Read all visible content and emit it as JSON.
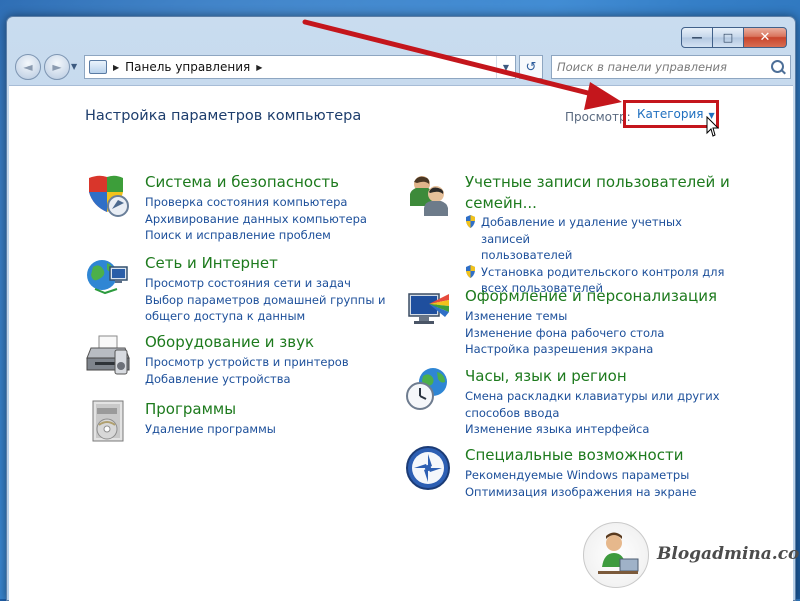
{
  "window": {
    "buttons": {
      "minimize": "—",
      "maximize": "□",
      "close": "✕"
    }
  },
  "nav": {
    "back_glyph": "◄",
    "forward_glyph": "►",
    "dropdown_glyph": "▼",
    "breadcrumb": "Панель управления",
    "separator": "▶",
    "refresh_glyph": "↺"
  },
  "search": {
    "placeholder": "Поиск в панели управления"
  },
  "page": {
    "title": "Настройка параметров компьютера",
    "view_label": "Просмотр:",
    "view_value": "Категория",
    "dropdown_glyph": "▼"
  },
  "categories": [
    {
      "title": "Система и безопасность",
      "icon": "shield-icon",
      "links": [
        "Проверка состояния компьютера",
        "Архивирование данных компьютера",
        "Поиск и исправление проблем"
      ]
    },
    {
      "title": "Сеть и Интернет",
      "icon": "network-globe-icon",
      "links": [
        "Просмотр состояния сети и задач",
        "Выбор параметров домашней группы и",
        "общего доступа к данным"
      ]
    },
    {
      "title": "Оборудование и звук",
      "icon": "printer-icon",
      "links": [
        "Просмотр устройств и принтеров",
        "Добавление устройства"
      ]
    },
    {
      "title": "Программы",
      "icon": "programs-disc-icon",
      "links": [
        "Удаление программы"
      ]
    },
    {
      "title": "Учетные записи пользователей и",
      "title2": "семейн...",
      "icon": "users-icon",
      "links": [
        "Добавление и удаление учетных записей",
        "пользователей",
        "Установка родительского контроля для",
        "всех пользователей"
      ]
    },
    {
      "title": "Оформление и персонализация",
      "icon": "monitor-palette-icon",
      "links": [
        "Изменение темы",
        "Изменение фона рабочего стола",
        "Настройка разрешения экрана"
      ]
    },
    {
      "title": "Часы, язык и регион",
      "icon": "clock-globe-icon",
      "links": [
        "Смена раскладки клавиатуры или других",
        "способов ввода",
        "Изменение языка интерфейса"
      ]
    },
    {
      "title": "Специальные возможности",
      "icon": "accessibility-icon",
      "links": [
        "Рекомендуемые Windows параметры",
        "Оптимизация изображения на экране"
      ]
    }
  ],
  "watermark": {
    "text": "Blogadmina.com"
  },
  "colors": {
    "accent": "#1f6fbf",
    "category_title": "#1d7a1d",
    "highlight": "#c4161c",
    "link": "#1c4f9a"
  }
}
